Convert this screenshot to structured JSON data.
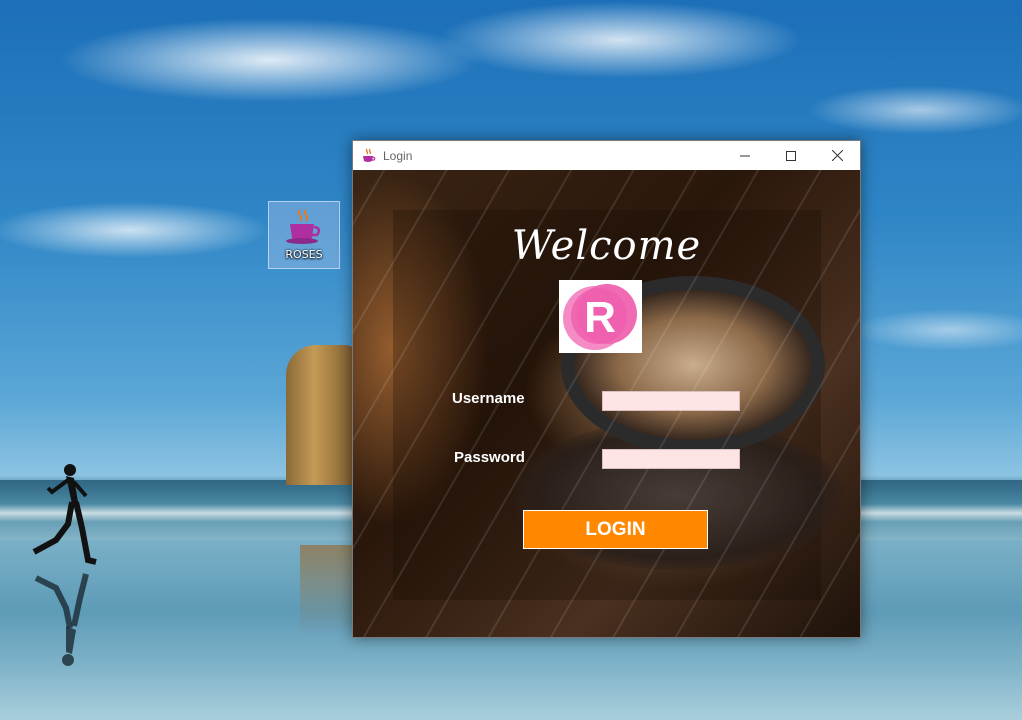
{
  "desktop": {
    "icon_label": "ROSES",
    "icon_name": "coffee-cup-icon"
  },
  "window": {
    "title": "Login",
    "controls": {
      "minimize_icon": "minimize-icon",
      "maximize_icon": "maximize-icon",
      "close_icon": "close-icon"
    }
  },
  "login_form": {
    "heading": "Welcome",
    "logo_letter": "R",
    "username_label": "Username",
    "username_value": "",
    "password_label": "Password",
    "password_value": "",
    "login_button": "LOGIN"
  },
  "colors": {
    "accent": "#ff8800",
    "input_bg": "#ffe4e6",
    "logo_pink": "#f06bb3"
  }
}
